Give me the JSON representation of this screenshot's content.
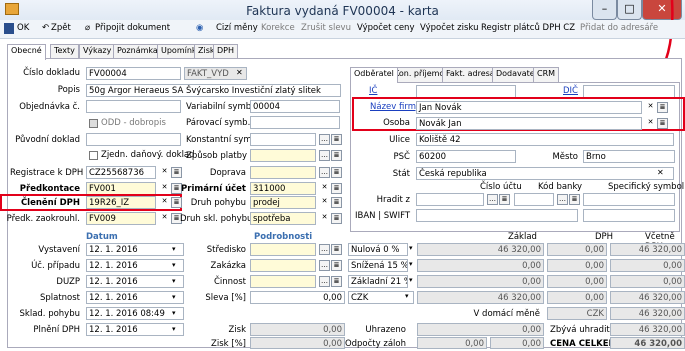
{
  "window": {
    "title": "Faktura vydaná FV00004 - karta"
  },
  "toolbar": {
    "ok": "OK",
    "back": "Zpět",
    "attach": "Připojit dokument",
    "foreign": "Cizí měny",
    "correction": "Korekce",
    "cancel_discount": "Zrušit slevu",
    "calc_prices": "Výpočet ceny",
    "calc_profit": "Výpočet zisku",
    "vat_registry": "Registr plátců DPH CZ",
    "add_address": "Přidat do adresáře"
  },
  "tabs": [
    "Obecné",
    "Texty",
    "Výkazy",
    "Poznámka",
    "Upomínky",
    "Zisk",
    "DPH"
  ],
  "right_tabs": [
    "Odběratel",
    "Kon. příjemce",
    "Fakt. adresa",
    "Dodavatel",
    "CRM"
  ],
  "form": {
    "doc_number_label": "Číslo dokladu",
    "doc_number": "FV00004",
    "doc_type": "FAKT_VYD",
    "desc_label": "Popis",
    "desc": "50g Argor Heraeus SA Švýcarsko Investiční zlatý slitek",
    "order_label": "Objednávka č.",
    "var_symbol_label": "Variabilní symb.",
    "var_symbol": "00004",
    "odd_label": "ODD - dobropis",
    "pair_symbol_label": "Párovací symb.",
    "orig_doc_label": "Původní doklad",
    "const_symbol_label": "Konstantní symb.",
    "simplified_label": "Zjedn. daňový. doklad",
    "payment_label": "Způsob platby",
    "vat_reg_label": "Registrace k DPH",
    "vat_reg": "CZ25568736",
    "transport_label": "Doprava",
    "prefix_label": "Předkontace",
    "prefix": "FV001",
    "primary_acc_label": "Primární účet",
    "primary_acc": "311000",
    "vat_split_label": "Členění DPH",
    "vat_split": "19R26_IZ",
    "payment_type_label": "Druh pohybu",
    "payment_type": "prodej",
    "advance_label": "Předk. zaokrouhl.",
    "advance": "FV009",
    "stock_move_label": "Druh skl. pohybu",
    "stock_move": "spotřeba"
  },
  "customer": {
    "ic_label": "IČ",
    "dic_label": "DIČ",
    "company_label": "Název firmy",
    "company": "Jan Novák",
    "person_label": "Osoba",
    "person": "Novák Jan",
    "street_label": "Ulice",
    "street": "Koliště 42",
    "zip_label": "PSČ",
    "zip": "60200",
    "city_label": "Město",
    "city": "Brno",
    "country_label": "Stát",
    "country": "Česká republika",
    "account_label": "Číslo účtu",
    "bank_label": "Kód banky",
    "specific_label": "Specifický symbol",
    "pay_from_label": "Hradit z",
    "iban_label": "IBAN | SWIFT"
  },
  "dates": {
    "header": "Datum",
    "issued_label": "Vystavení",
    "issued": "12. 1. 2016",
    "account_label": "Úč. případu",
    "account": "12. 1. 2016",
    "duzp_label": "DUZP",
    "duzp": "12. 1. 2016",
    "due_label": "Splatnost",
    "due": "12. 1. 2016",
    "stock_label": "Sklad. pohybu",
    "stock": "12. 1. 2016 08:49",
    "plneni_label": "Plnění DPH",
    "plneni": "12. 1. 2016"
  },
  "details": {
    "header": "Podrobnosti",
    "center_label": "Středisko",
    "order_label": "Zakázka",
    "activity_label": "Činnost",
    "discount_label": "Sleva [%]",
    "discount": "0,00",
    "profit_label": "Zisk",
    "profit": "0,00",
    "profit_pct_label": "Zisk [%]",
    "profit_pct": "0,00"
  },
  "summary": {
    "base_header": "Základ",
    "vat_header": "DPH",
    "total_header": "Včetně DPH",
    "rows": [
      {
        "label": "Nulová 0 %",
        "base": "46 320,00",
        "vat": "0,00",
        "total": "46 320,00"
      },
      {
        "label": "Snížená 15 %",
        "base": "0,00",
        "vat": "0,00",
        "total": "0,00"
      },
      {
        "label": "Základní 21 %",
        "base": "0,00",
        "vat": "0,00",
        "total": "0,00"
      }
    ],
    "currency": "CZK",
    "cur_base": "46 320,00",
    "cur_vat": "0,00",
    "cur_total": "46 320,00",
    "domestic_label": "V domácí měně",
    "domestic_cur": "CZK",
    "domestic_total": "46 320,00",
    "rounding_label": "Uhrazeno",
    "paid": "0,00",
    "to_pay_label": "Zbývá uhradit",
    "to_pay": "46 320,00",
    "adv_label": "Odpočty záloh",
    "adv": "0,00",
    "adv_vat": "0,00",
    "total_label": "CENA CELKEM",
    "grand_total": "46 320,00"
  }
}
